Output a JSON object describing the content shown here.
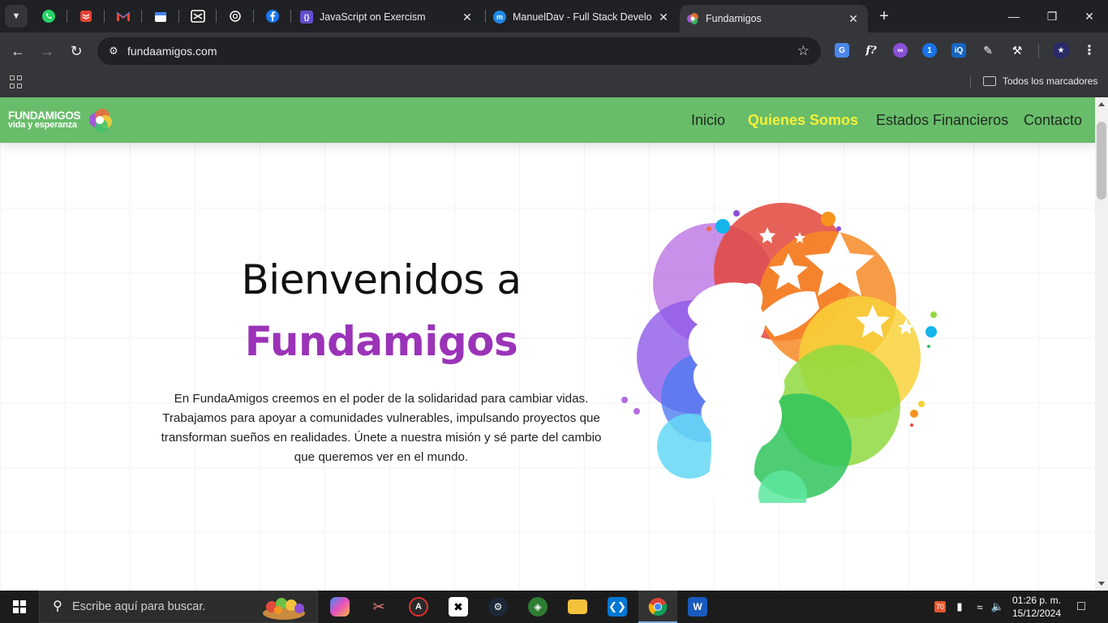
{
  "browser": {
    "tabs": [
      {
        "title": "JavaScript on Exercism",
        "favicon": "exercism-icon",
        "active": false
      },
      {
        "title": "ManuelDav - Full Stack Develop",
        "favicon": "manueldav-icon",
        "active": false
      },
      {
        "title": "Fundamigos",
        "favicon": "fundamigos-icon",
        "active": true
      }
    ],
    "pinned_tabs": [
      "whatsapp-icon",
      "todoist-icon",
      "gmail-icon",
      "calendar-icon",
      "capcut-icon",
      "chatgpt-icon",
      "facebook-icon"
    ],
    "address": "fundaamigos.com",
    "bookmarks_all": "Todos los marcadores"
  },
  "site": {
    "logo_line1": "FUNDAMIGOS",
    "logo_line2": "vida y esperanza",
    "nav": {
      "inicio": "Inicio",
      "quienes": "Quienes Somos",
      "estados": "Estados Financieros",
      "contacto": "Contacto"
    },
    "hero": {
      "title_line1": "Bienvenidos a",
      "title_line2": "Fundamigos",
      "paragraph": "En FundaAmigos creemos en el poder de la solidaridad para cambiar vidas. Trabajamos para apoyar a comunidades vulnerables, impulsando proyectos que transforman sueños en realidades. Únete a nuestra misión y sé parte del cambio que queremos ver en el mundo."
    },
    "colors": {
      "nav_bg": "#68bd6a",
      "nav_active": "#f6f03a",
      "accent_purple": "#9a33b8"
    }
  },
  "taskbar": {
    "search_placeholder": "Escribe aquí para buscar.",
    "apps": [
      "copilot-icon",
      "snipping-tool-icon",
      "antigravity-icon",
      "capcut-icon",
      "steam-icon",
      "gecko-icon",
      "file-explorer-icon",
      "vscode-icon",
      "chrome-icon",
      "word-icon"
    ],
    "tray_badge": "70",
    "time": "01:26 p. m.",
    "date": "15/12/2024"
  }
}
